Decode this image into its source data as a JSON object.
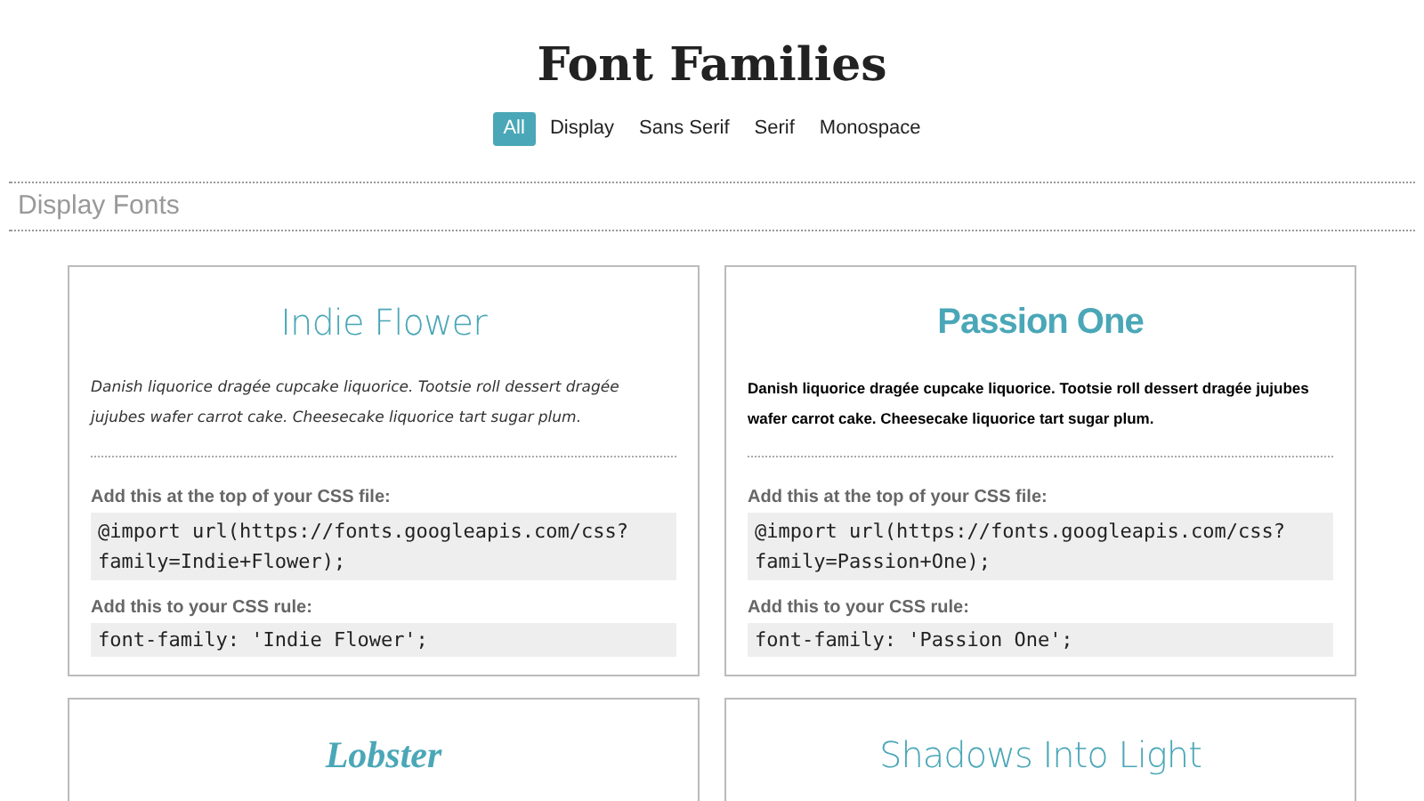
{
  "title": "Font Families",
  "filters": [
    {
      "label": "All",
      "selected": true
    },
    {
      "label": "Display",
      "selected": false
    },
    {
      "label": "Sans Serif",
      "selected": false
    },
    {
      "label": "Serif",
      "selected": false
    },
    {
      "label": "Monospace",
      "selected": false
    }
  ],
  "section": {
    "heading": "Display Fonts"
  },
  "cards": [
    {
      "name": "Indie Flower",
      "kind": "hand",
      "sample": "Danish liquorice dragée cupcake liquorice. Tootsie roll dessert dragée jujubes wafer carrot cake. Cheesecake liquorice tart sugar plum.",
      "import_label": "Add this at the top of your CSS file:",
      "import_code": [
        "@import url(https://fonts.googleapis.com/css?",
        "family=Indie+Flower);"
      ],
      "rule_label": "Add this to your CSS rule:",
      "rule_code": "font-family: 'Indie Flower';"
    },
    {
      "name": "Passion One",
      "kind": "heavy",
      "sample": "Danish liquorice dragée cupcake liquorice. Tootsie roll dessert dragée jujubes wafer carrot cake. Cheesecake liquorice tart sugar plum.",
      "import_label": "Add this at the top of your CSS file:",
      "import_code": [
        "@import url(https://fonts.googleapis.com/css?",
        "family=Passion+One);"
      ],
      "rule_label": "Add this to your CSS rule:",
      "rule_code": "font-family: 'Passion One';"
    },
    {
      "name": "Lobster",
      "kind": "script"
    },
    {
      "name": "Shadows Into Light",
      "kind": "hand"
    }
  ]
}
